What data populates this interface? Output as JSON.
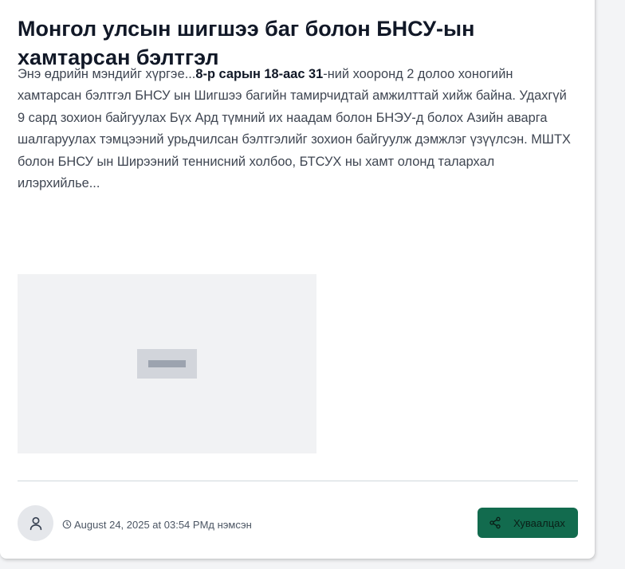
{
  "post": {
    "title": "Монгол улсын шигшээ баг болон БНСУ-ын хамтарсан бэлтгэл",
    "excerpt": {
      "intro": "Энэ өдрийн мэндийг хүргэе...",
      "date_range": "8-р сарын 18-аас 31",
      "body": "-ний хооронд 2 долоо хоногийн хамтарсан бэлтгэл БНСУ ын Шигшээ багийн тамирчидтай амжилттай хийж байна. Удахгүй 9 сард зохион байгуулах Бүх Ард түмний их наадам болон БНЭУ-д болох Азийн аварга шалгаруулах тэмцээний урьдчилсан бэлтгэлийг зохион байгуулж дэмжлэг үзүүлсэн. МШТХ болон БНСУ ын Ширээний теннисний холбоо, БТСУХ ны хамт олонд талархал илэрхийлье..."
    },
    "image": {
      "icon": "image-placeholder-icon"
    },
    "footer": {
      "avatar_icon": "user-icon",
      "clock_icon": "clock-icon",
      "posted_at": "August 24, 2025 at 03:54 PMд нэмсэн",
      "share_label": "Хуваалцах",
      "share_icon": "share-icon"
    }
  },
  "colors": {
    "title": "#111827",
    "text": "#3f4652",
    "share_button_bg": "#126b4e",
    "avatar_bg": "#e5e7eb",
    "image_bg": "#f1f2f4",
    "divider": "#cfd8dc"
  }
}
